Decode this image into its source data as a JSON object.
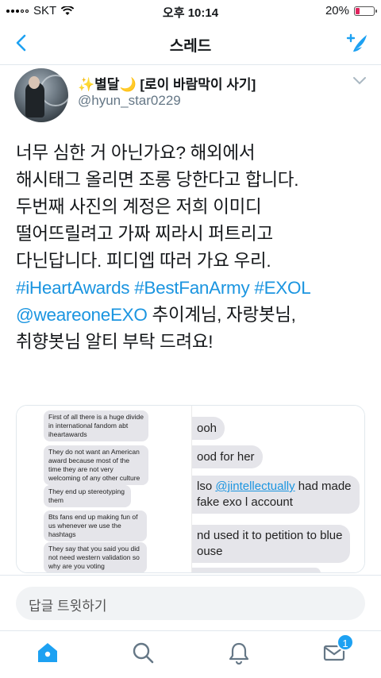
{
  "status_bar": {
    "carrier": "SKT",
    "time": "오후 10:14",
    "battery": "20%"
  },
  "nav": {
    "title": "스레드"
  },
  "tweet": {
    "display_name": "✨별달🌙 [로이 바람막이 사기]",
    "handle": "@hyun_star0229",
    "lines": [
      "너무 심한 거 아닌가요? 해외에서",
      "해시태그 올리면 조롱 당한다고 합니다.",
      "두번째 사진의 계정은 저희 이미디",
      "떨어뜨릴려고 가짜 찌라시 퍼트리고",
      "다닌답니다. 피디엡 따러 가요 우리."
    ],
    "hashtags": [
      "#iHeartAwards",
      "#BestFanArmy",
      "#EXOL"
    ],
    "mention": "@weareoneEXO",
    "line_after_mention": " 추이계님, 자랑봇님,",
    "last_line": "취향봇님 알티 부탁 드려요!"
  },
  "media": {
    "left_bubbles": [
      "First of all there is a huge divide in international fandom abt iheartawards",
      "They do not want an American award because most of the time they are not very welcoming of any other culture",
      "They end up stereotyping them",
      "Bts fans end up making fun of us whenever we use the hashtags",
      "They say that you said you did not need western validation so why are you voting"
    ],
    "right_bubbles": {
      "b1": "ooh",
      "b2": "ood for her",
      "b3_pre": "lso ",
      "b3_mention": "@jintellectually",
      "b3_post": " had made",
      "b4": "fake exo l account",
      "b5": "nd used it to petition to blue",
      "b6": "ouse"
    }
  },
  "reply": {
    "placeholder": "답글 트윗하기"
  },
  "tabbar": {
    "message_badge": "1",
    "accent": "#1da1f2"
  }
}
